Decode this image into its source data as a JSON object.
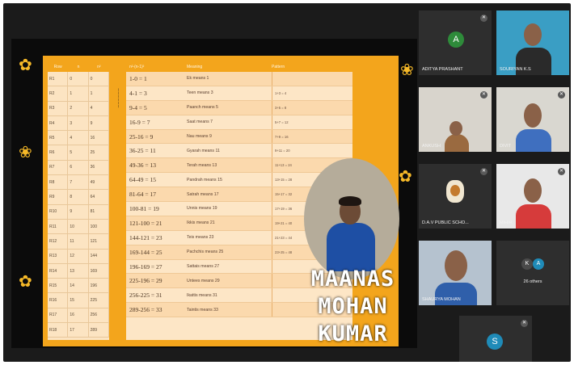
{
  "presentation": {
    "presenter_name_line1": "MAANAS",
    "presenter_name_line2": "MOHAN KUMAR",
    "left_table_headers": [
      "Row",
      "n",
      "n²"
    ],
    "left_table_rows": [
      [
        "R1",
        "0",
        "0"
      ],
      [
        "R2",
        "1",
        "1"
      ],
      [
        "R3",
        "2",
        "4"
      ],
      [
        "R4",
        "3",
        "9"
      ],
      [
        "R5",
        "4",
        "16"
      ],
      [
        "R6",
        "5",
        "25"
      ],
      [
        "R7",
        "6",
        "36"
      ],
      [
        "R8",
        "7",
        "49"
      ],
      [
        "R9",
        "8",
        "64"
      ],
      [
        "R10",
        "9",
        "81"
      ],
      [
        "R11",
        "10",
        "100"
      ],
      [
        "R12",
        "11",
        "121"
      ],
      [
        "R13",
        "12",
        "144"
      ],
      [
        "R14",
        "13",
        "169"
      ],
      [
        "R15",
        "14",
        "196"
      ],
      [
        "R16",
        "15",
        "225"
      ],
      [
        "R17",
        "16",
        "256"
      ],
      [
        "R18",
        "17",
        "289"
      ]
    ],
    "main_table_headers": [
      "n²-(n-1)²",
      "Meaning",
      "Pattern"
    ],
    "main_table_rows": [
      [
        "1-0 = 1",
        "Ek means 1",
        ""
      ],
      [
        "4-1 = 3",
        "Teen means 3",
        "1+3 = 4"
      ],
      [
        "9-4 = 5",
        "Paanch means 5",
        "3+5 = 8"
      ],
      [
        "16-9 = 7",
        "Saat means 7",
        "5+7 = 12"
      ],
      [
        "25-16 = 9",
        "Nau means 9",
        "7+9 = 16"
      ],
      [
        "36-25 = 11",
        "Gyarah means 11",
        "9+11 = 20"
      ],
      [
        "49-36 = 13",
        "Terah means 13",
        "11+13 = 24"
      ],
      [
        "64-49 = 15",
        "Pandrah means 15",
        "13+15 = 28"
      ],
      [
        "81-64 = 17",
        "Satrah means 17",
        "15+17 = 32"
      ],
      [
        "100-81 = 19",
        "Unnis means 19",
        "17+19 = 36"
      ],
      [
        "121-100 = 21",
        "Ikkis means 21",
        "19+21 = 40"
      ],
      [
        "144-121 = 23",
        "Teis means 23",
        "21+23 = 44"
      ],
      [
        "169-144 = 25",
        "Pachchis means 25",
        "23+25 = 48"
      ],
      [
        "196-169 = 27",
        "Sattais means 27",
        ""
      ],
      [
        "225-196 = 29",
        "Untees means 29",
        ""
      ],
      [
        "256-225 = 31",
        "Ikattis means 31",
        ""
      ],
      [
        "289-256 = 33",
        "Taintis means 33",
        ""
      ]
    ]
  },
  "participants": [
    {
      "name": "ADITYA PRASHANT",
      "avatar_letter": "A",
      "avatar_color": "#2e8b3a",
      "type": "avatar"
    },
    {
      "name": "SOURIYAN K.S",
      "type": "video",
      "bg": "#3a9ec4",
      "shirt": "#2a2a2a"
    },
    {
      "name": "ANKUSH",
      "type": "video",
      "bg": "#d8d4cc",
      "shirt": "#9a6a40"
    },
    {
      "name": "DIVIT",
      "type": "video",
      "bg": "#d9d7d0",
      "shirt": "#3f6fbf"
    },
    {
      "name": "D.A.V PUBLIC SCHO...",
      "type": "logo",
      "bg": "#2e2e2e"
    },
    {
      "name": "MIHIR",
      "type": "video",
      "bg": "#e8e8e8",
      "shirt": "#d63b3b"
    },
    {
      "name": "SHAURYA MOHAN",
      "type": "video",
      "bg": "#b5c2cf",
      "shirt": "#2f5faa"
    },
    {
      "name": "26 others",
      "type": "others",
      "bg": "#2e2e2e"
    },
    {
      "name": "",
      "avatar_letter": "S",
      "avatar_color": "#1f8bb8",
      "type": "avatar"
    }
  ]
}
